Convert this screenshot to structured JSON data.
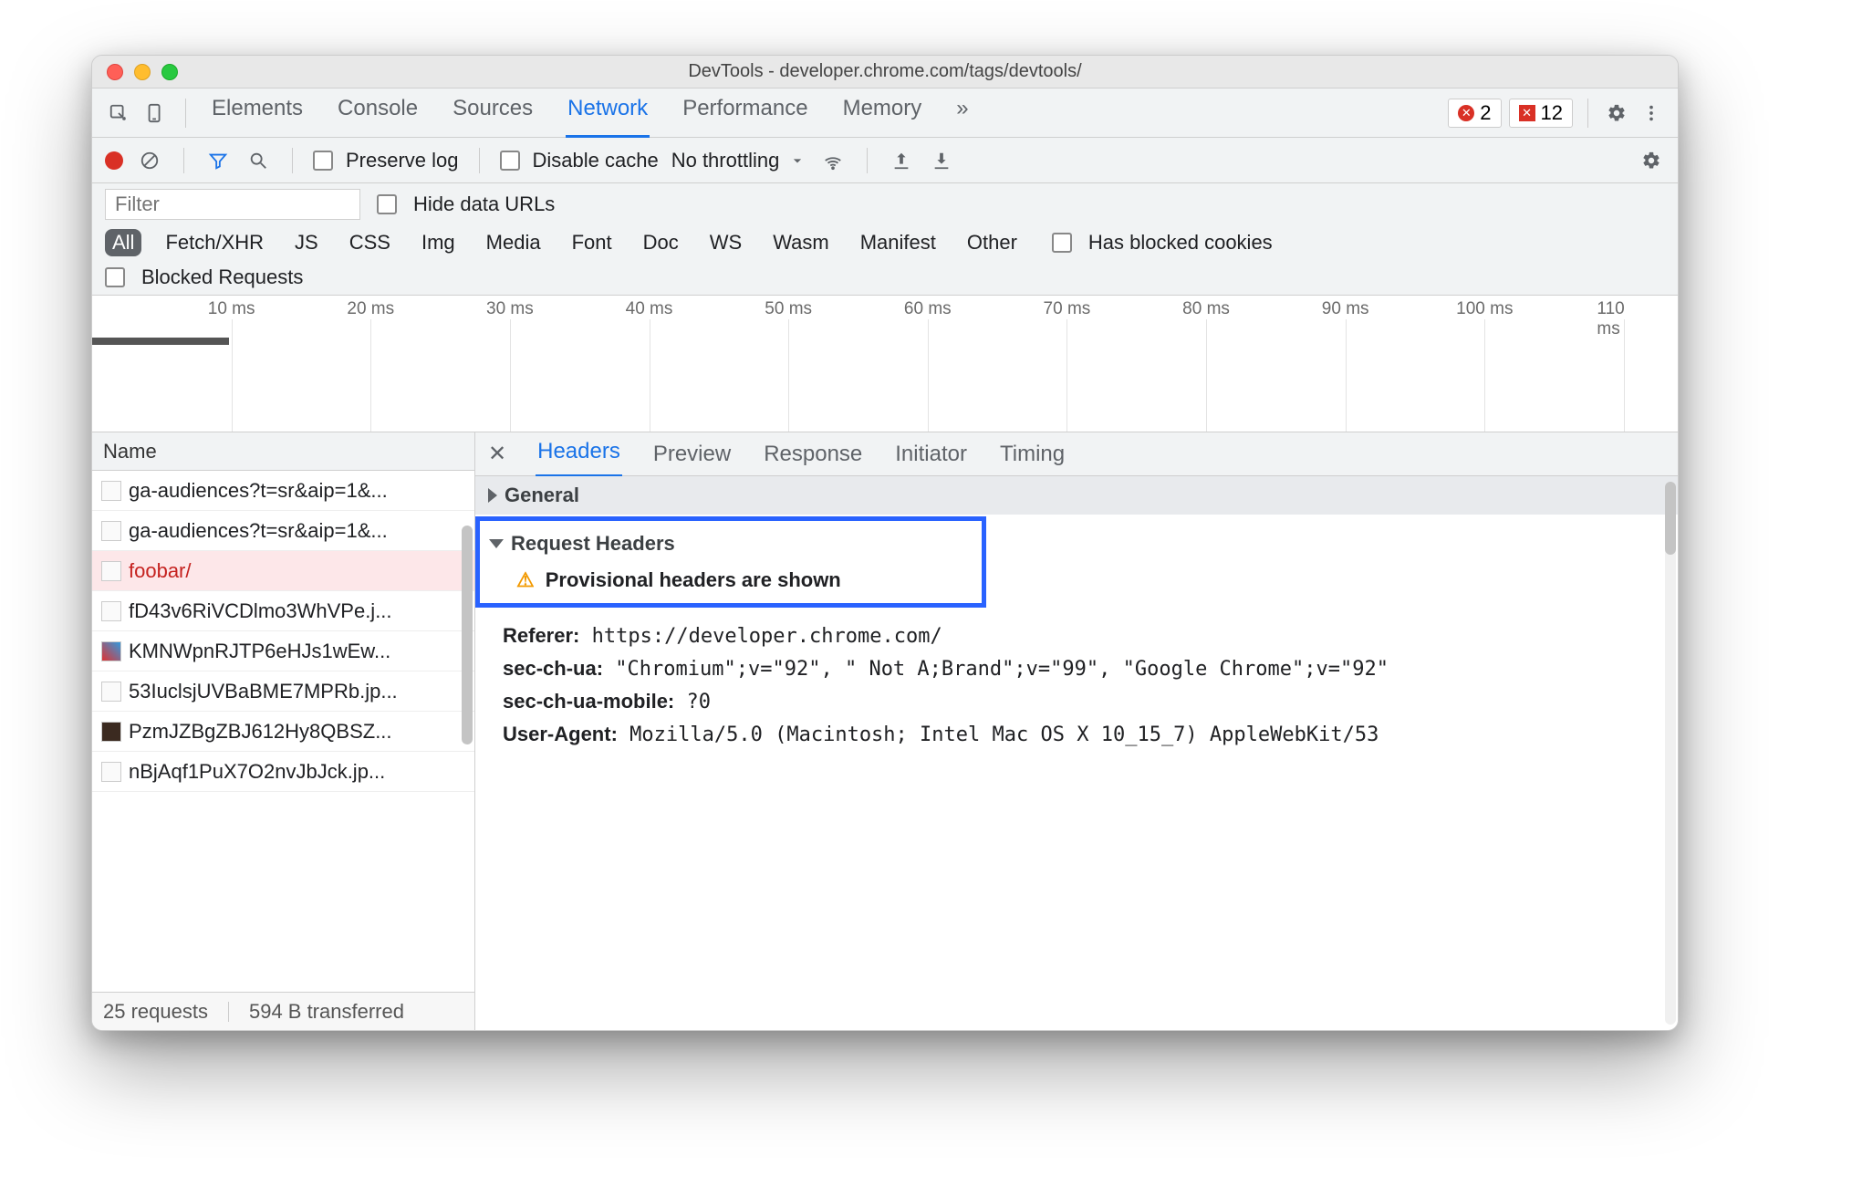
{
  "window": {
    "title": "DevTools - developer.chrome.com/tags/devtools/"
  },
  "panelTabs": {
    "elements": "Elements",
    "console": "Console",
    "sources": "Sources",
    "network": "Network",
    "performance": "Performance",
    "memory": "Memory",
    "more": "»"
  },
  "counts": {
    "errorsCircle": "2",
    "errorsSquare": "12"
  },
  "net": {
    "preserveLog": "Preserve log",
    "disableCache": "Disable cache",
    "throttling": "No throttling",
    "filterPlaceholder": "Filter",
    "hideDataUrls": "Hide data URLs",
    "types": [
      "All",
      "Fetch/XHR",
      "JS",
      "CSS",
      "Img",
      "Media",
      "Font",
      "Doc",
      "WS",
      "Wasm",
      "Manifest",
      "Other"
    ],
    "hasBlockedCookies": "Has blocked cookies",
    "blockedRequests": "Blocked Requests"
  },
  "timelineTicks": [
    "10 ms",
    "20 ms",
    "30 ms",
    "40 ms",
    "50 ms",
    "60 ms",
    "70 ms",
    "80 ms",
    "90 ms",
    "100 ms",
    "110 ms"
  ],
  "requestList": {
    "column": "Name",
    "rows": [
      {
        "name": "ga-audiences?t=sr&aip=1&..."
      },
      {
        "name": "ga-audiences?t=sr&aip=1&..."
      },
      {
        "name": "foobar/"
      },
      {
        "name": "fD43v6RiVCDlmo3WhVPe.j..."
      },
      {
        "name": "KMNWpnRJTP6eHJs1wEw..."
      },
      {
        "name": "53IuclsjUVBaBME7MPRb.jp..."
      },
      {
        "name": "PzmJZBgZBJ612Hy8QBSZ..."
      },
      {
        "name": "nBjAqf1PuX7O2nvJbJck.jp..."
      }
    ],
    "status": {
      "requests": "25 requests",
      "transferred": "594 B transferred"
    }
  },
  "detail": {
    "tabs": {
      "headers": "Headers",
      "preview": "Preview",
      "response": "Response",
      "initiator": "Initiator",
      "timing": "Timing"
    },
    "sections": {
      "general": "General",
      "requestHeaders": "Request Headers",
      "provisional": "Provisional headers are shown"
    },
    "headers": {
      "referer_k": "Referer:",
      "referer_v": "https://developer.chrome.com/",
      "secchua_k": "sec-ch-ua:",
      "secchua_v": "\"Chromium\";v=\"92\", \" Not A;Brand\";v=\"99\", \"Google Chrome\";v=\"92\"",
      "secchuamobile_k": "sec-ch-ua-mobile:",
      "secchuamobile_v": "?0",
      "ua_k": "User-Agent:",
      "ua_v": "Mozilla/5.0 (Macintosh; Intel Mac OS X 10_15_7) AppleWebKit/53"
    }
  }
}
